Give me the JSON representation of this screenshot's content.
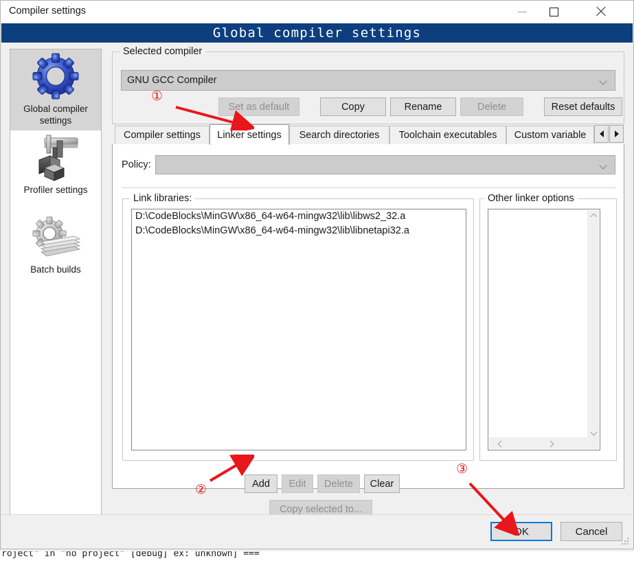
{
  "window": {
    "title": "Compiler settings",
    "caption": "Global compiler settings",
    "controls": {
      "minimize": "minimize",
      "maximize": "maximize",
      "close": "close"
    }
  },
  "sidebar": {
    "items": [
      {
        "label": "Global compiler settings",
        "icon": "blue-gear-icon",
        "selected": true
      },
      {
        "label": "Profiler settings",
        "icon": "caliper-cubes-icon",
        "selected": false
      },
      {
        "label": "Batch builds",
        "icon": "gear-stack-icon",
        "selected": false
      }
    ]
  },
  "compiler_group": {
    "legend": "Selected compiler",
    "combo_value": "GNU GCC Compiler",
    "buttons": [
      {
        "label": "Set as default",
        "enabled": false
      },
      {
        "label": "Copy",
        "enabled": true
      },
      {
        "label": "Rename",
        "enabled": true
      },
      {
        "label": "Delete",
        "enabled": false
      },
      {
        "label": "Reset defaults",
        "enabled": true
      }
    ]
  },
  "tabs": {
    "items": [
      {
        "label": "Compiler settings",
        "active": false
      },
      {
        "label": "Linker settings",
        "active": true
      },
      {
        "label": "Search directories",
        "active": false
      },
      {
        "label": "Toolchain executables",
        "active": false
      },
      {
        "label": "Custom variable",
        "active": false
      }
    ],
    "scroll_prev": "scroll-tabs-left",
    "scroll_next": "scroll-tabs-right"
  },
  "linker": {
    "policy_label": "Policy:",
    "policy_value": "",
    "link_libraries": {
      "legend": "Link libraries:",
      "items": [
        "D:\\CodeBlocks\\MinGW\\x86_64-w64-mingw32\\lib\\libws2_32.a",
        "D:\\CodeBlocks\\MinGW\\x86_64-w64-mingw32\\lib\\libnetapi32.a"
      ],
      "buttons": [
        {
          "label": "Add",
          "enabled": true
        },
        {
          "label": "Edit",
          "enabled": false
        },
        {
          "label": "Delete",
          "enabled": false
        },
        {
          "label": "Clear",
          "enabled": true
        }
      ],
      "copy_selected": {
        "label": "Copy selected to...",
        "enabled": false
      }
    },
    "move_buttons": [
      {
        "name": "move-up",
        "enabled": false
      },
      {
        "name": "move-down",
        "enabled": false
      }
    ],
    "other_linker_options": {
      "legend": "Other linker options",
      "value": ""
    }
  },
  "footer": {
    "ok": "OK",
    "cancel": "Cancel"
  },
  "annotations": [
    {
      "marker": "①",
      "target": "linker-settings-tab"
    },
    {
      "marker": "②",
      "target": "add-button"
    },
    {
      "marker": "③",
      "target": "ok-button"
    }
  ],
  "console": {
    "clipped_text": "roject\" in \"no project\" [debug] ex: unknown] ==="
  }
}
